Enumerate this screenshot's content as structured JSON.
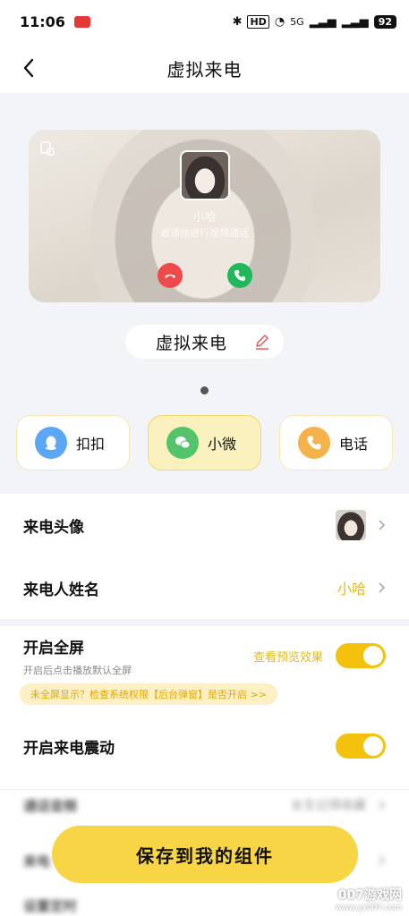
{
  "status_bar": {
    "time": "11:06",
    "network": "5G",
    "battery": "92",
    "hd": "HD"
  },
  "header": {
    "title": "虚拟来电"
  },
  "preview": {
    "caller_name": "小哈",
    "subtitle": "邀请你进行视频通话"
  },
  "widget_name": "虚拟来电",
  "apps": [
    {
      "label": "扣扣",
      "icon": "qq-icon",
      "color": "#5ba7f5"
    },
    {
      "label": "小微",
      "icon": "wechat-icon",
      "color": "#52c46b"
    },
    {
      "label": "电话",
      "icon": "phone-icon",
      "color": "#f5b24a"
    }
  ],
  "settings": {
    "avatar_label": "来电头像",
    "name_label": "来电人姓名",
    "name_value": "小哈",
    "fullscreen_label": "开启全屏",
    "fullscreen_sub": "开启后点击播放默认全屏",
    "preview_link": "查看预览效果",
    "hint": "未全屏显示？检查系统权限【后台弹窗】是否开启 >>",
    "vibrate_label": "开启来电震动",
    "ringtone_label": "通话音频",
    "ringtone_value": "女生记得收藏",
    "row7_label": "来电",
    "row8_label": "设置定时"
  },
  "save_button": "保存到我的组件",
  "watermark": {
    "line1": "007游戏网",
    "line2": "www.yx007.com"
  },
  "colors": {
    "accent": "#f8d545",
    "accent_text": "#e8b81b"
  }
}
